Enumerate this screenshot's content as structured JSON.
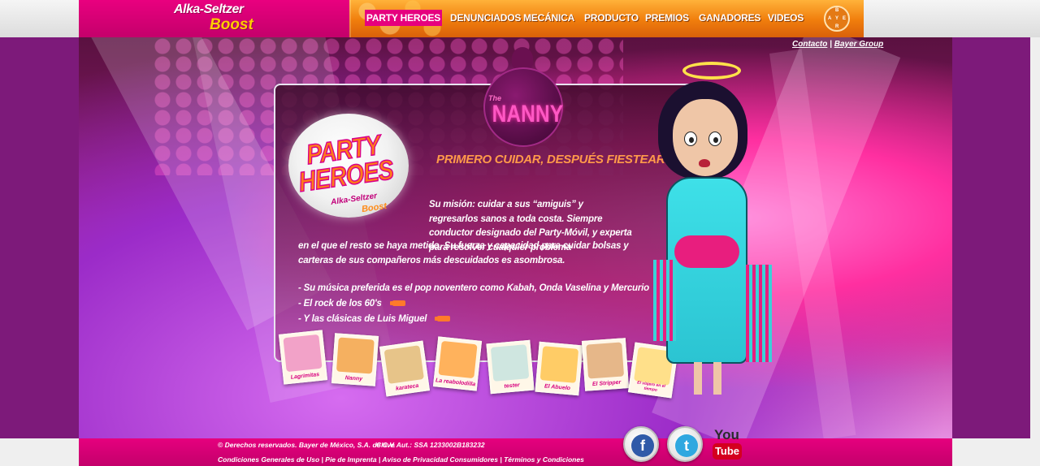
{
  "header": {
    "logo_top": "Alka-Seltzer",
    "logo_bottom": "Boost",
    "nav": [
      {
        "label": "PARTY HEROES",
        "active": true
      },
      {
        "label": "DENUNCIADOS"
      },
      {
        "label": "MECÁNICA"
      },
      {
        "label": "PRODUCTO"
      },
      {
        "label": "PREMIOS"
      },
      {
        "label": "GANADORES"
      },
      {
        "label": "VIDEOS"
      }
    ],
    "bayer_logo": {
      "b1": "B",
      "a": "A",
      "y": "Y",
      "e": "E",
      "r": "R"
    }
  },
  "top_links": {
    "contacto": "Contacto",
    "separator": "|",
    "bayer_group": "Bayer Group"
  },
  "character": {
    "the": "The",
    "name": "NANNY",
    "tagline": "PRIMERO CUIDAR, DESPUÉS FIESTEAR.",
    "description_1": "Su misión: cuidar a sus “amiguis” y regresarlos sanos a toda costa. Siempre conductor designado del Party-Móvil, y experta para resolver cualquier problema",
    "description_2": "en el que el resto se haya metido. Su fuerza y capacidad para cuidar bolsas y carteras de sus compañeros más descuidados es asombrosa.",
    "music": [
      "- Su música preferida es el pop noventero como Kabah, Onda Vaselina y Mercurio",
      "- El rock de los 60's",
      "- Y las clásicas de Luis Miguel"
    ]
  },
  "badge": {
    "line1": "PARTY",
    "line2": "HEROES",
    "brand1": "Alka-Seltzer",
    "brand2": "Boost"
  },
  "cards": [
    {
      "label": "Lagrimitas",
      "color": "#f2a2c8"
    },
    {
      "label": "Nanny",
      "color": "#f5b060"
    },
    {
      "label": "karateca",
      "color": "#e7c489"
    },
    {
      "label": "La reabolodilla",
      "color": "#ffb25c"
    },
    {
      "label": "tester",
      "color": "#cfe6e0"
    },
    {
      "label": "El Abuelo",
      "color": "#ffcc66"
    },
    {
      "label": "El Stripper",
      "color": "#e6b789"
    },
    {
      "label": "El viajero en el tiempo",
      "color": "#ffe08a"
    }
  ],
  "footer": {
    "copyright": "© Derechos reservados. Bayer de México, S.A. de C.V.",
    "clave": "Clave Aut.: SSA 1233002B183232",
    "links": "Condiciones Generales de Uso | Pie de Imprenta | Aviso de Privacidad Consumidores | Términos y Condiciones"
  },
  "social": {
    "facebook": "f",
    "twitter": "t",
    "youtube_you": "You",
    "youtube_tube": "Tube"
  },
  "colors": {
    "brand_pink": "#e6007e",
    "nav_orange": "#f07d0c",
    "tagline_orange": "#ff9a4a"
  }
}
